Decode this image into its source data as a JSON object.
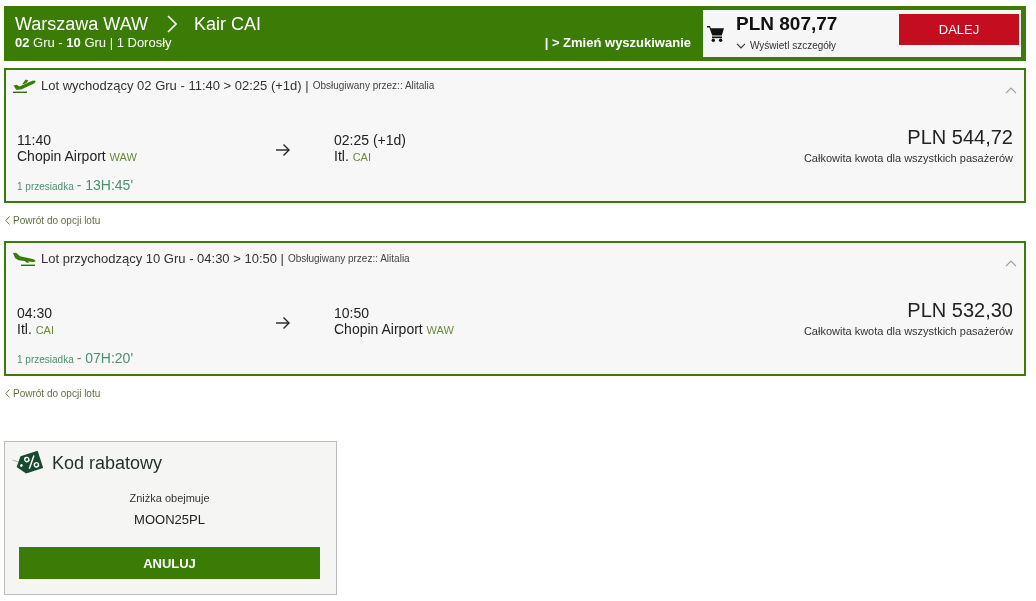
{
  "header": {
    "origin": "Warszawa WAW",
    "destination": "Kair CAI",
    "trip_info": "**02** Gru - **10** Gru | 1 Dorosły",
    "change_search": "| > Zmień wyszukiwanie"
  },
  "cart": {
    "total": "PLN 807,77",
    "details_link": "Wyświetl szczegóły",
    "next_button": "DALEJ"
  },
  "flights": [
    {
      "kind": "outbound",
      "title": "Lot wychodzący 02 Gru - 11:40 > 02:25 (+1d) |",
      "operator": "Obsługiwany przez:: Alitalia",
      "expanded": true,
      "departure": {
        "time": "11:40",
        "airport": "Chopin Airport",
        "code": "WAW"
      },
      "arrival": {
        "time": "02:25 (+1d)",
        "airport": "Itl.",
        "code": "CAI"
      },
      "stops": "1 przesiadka",
      "duration": "- 13H:45'",
      "price": "PLN 544,72",
      "price_note": "Całkowita kwota dla wszystkich pasażerów",
      "back_link": "Powrót do opcji lotu"
    },
    {
      "kind": "inbound",
      "title": "Lot przychodzący 10 Gru - 04:30 > 10:50 |",
      "operator": "Obsługiwany przez:: Alitalia",
      "expanded": true,
      "departure": {
        "time": "04:30",
        "airport": "Itl.",
        "code": "CAI"
      },
      "arrival": {
        "time": "10:50",
        "airport": "Chopin Airport",
        "code": "WAW"
      },
      "stops": "1 przesiadka",
      "duration": "- 07H:20'",
      "price": "PLN 532,30",
      "price_note": "Całkowita kwota dla wszystkich pasażerów",
      "back_link": "Powrót do opcji lotu"
    }
  ],
  "discount": {
    "title": "Kod rabatowy",
    "label": "Zniżka obejmuje",
    "code": "MOON25PL",
    "cancel_button": "ANULUJ"
  }
}
